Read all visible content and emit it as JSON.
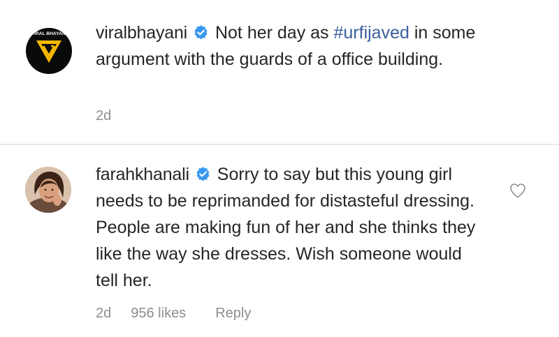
{
  "post": {
    "username": "viralbhayani",
    "avatar_ring_text": "VIRAL BHAYANI",
    "avatar_monogram": "VB",
    "text_before": "Not her day as ",
    "hashtag": "#urfijaved",
    "text_after": " in some argument with the guards of a office building.",
    "time": "2d"
  },
  "comment": {
    "username": "farahkhanali",
    "text": "Sorry to say but this young girl needs to be reprimanded for distasteful dressing. People are making fun of her and she thinks they like the way she dresses. Wish someone would tell her.",
    "time": "2d",
    "likes": "956 likes",
    "reply_label": "Reply"
  },
  "colors": {
    "verified_badge": "#3897f0",
    "hashtag": "#3a5f9e",
    "meta_text": "#8e8e8e",
    "logo_yellow": "#f5b800"
  },
  "icons": {
    "verified": "verified-badge-icon",
    "like": "heart-outline-icon"
  }
}
